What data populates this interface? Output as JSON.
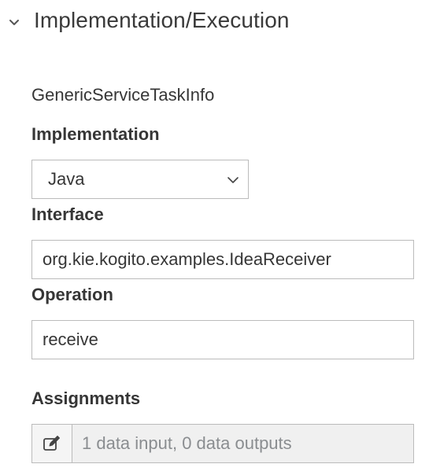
{
  "section": {
    "title": "Implementation/Execution",
    "toggle_icon": "chevron-down-icon"
  },
  "group": {
    "title": "GenericServiceTaskInfo"
  },
  "implementation": {
    "label": "Implementation",
    "selected": "Java",
    "caret_icon": "chevron-down-icon"
  },
  "interface": {
    "label": "Interface",
    "value": "org.kie.kogito.examples.IdeaReceiver"
  },
  "operation": {
    "label": "Operation",
    "value": "receive"
  },
  "assignments": {
    "label": "Assignments",
    "summary": "1 data input, 0 data outputs",
    "edit_icon": "edit-icon"
  }
}
